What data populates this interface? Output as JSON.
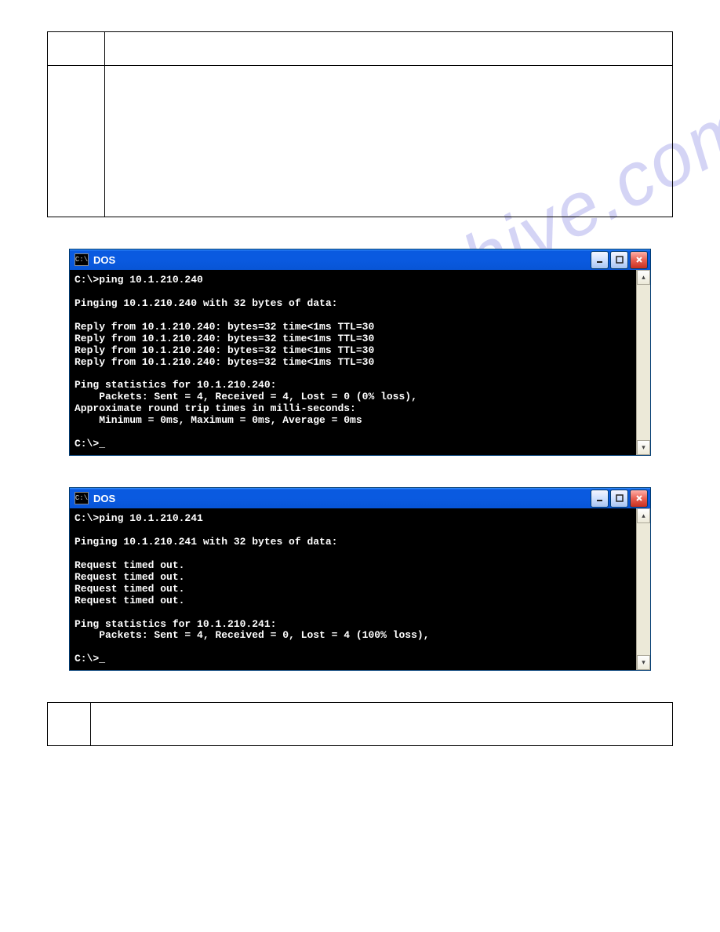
{
  "watermark": "manualshive.com",
  "window1": {
    "icon_label": "C:\\",
    "title": "DOS",
    "console_lines": [
      "C:\\>ping 10.1.210.240",
      "",
      "Pinging 10.1.210.240 with 32 bytes of data:",
      "",
      "Reply from 10.1.210.240: bytes=32 time<1ms TTL=30",
      "Reply from 10.1.210.240: bytes=32 time<1ms TTL=30",
      "Reply from 10.1.210.240: bytes=32 time<1ms TTL=30",
      "Reply from 10.1.210.240: bytes=32 time<1ms TTL=30",
      "",
      "Ping statistics for 10.1.210.240:",
      "    Packets: Sent = 4, Received = 4, Lost = 0 (0% loss),",
      "Approximate round trip times in milli-seconds:",
      "    Minimum = 0ms, Maximum = 0ms, Average = 0ms",
      "",
      "C:\\>_"
    ]
  },
  "window2": {
    "icon_label": "C:\\",
    "title": "DOS",
    "console_lines": [
      "C:\\>ping 10.1.210.241",
      "",
      "Pinging 10.1.210.241 with 32 bytes of data:",
      "",
      "Request timed out.",
      "Request timed out.",
      "Request timed out.",
      "Request timed out.",
      "",
      "Ping statistics for 10.1.210.241:",
      "    Packets: Sent = 4, Received = 0, Lost = 4 (100% loss),",
      "",
      "C:\\>_"
    ]
  }
}
